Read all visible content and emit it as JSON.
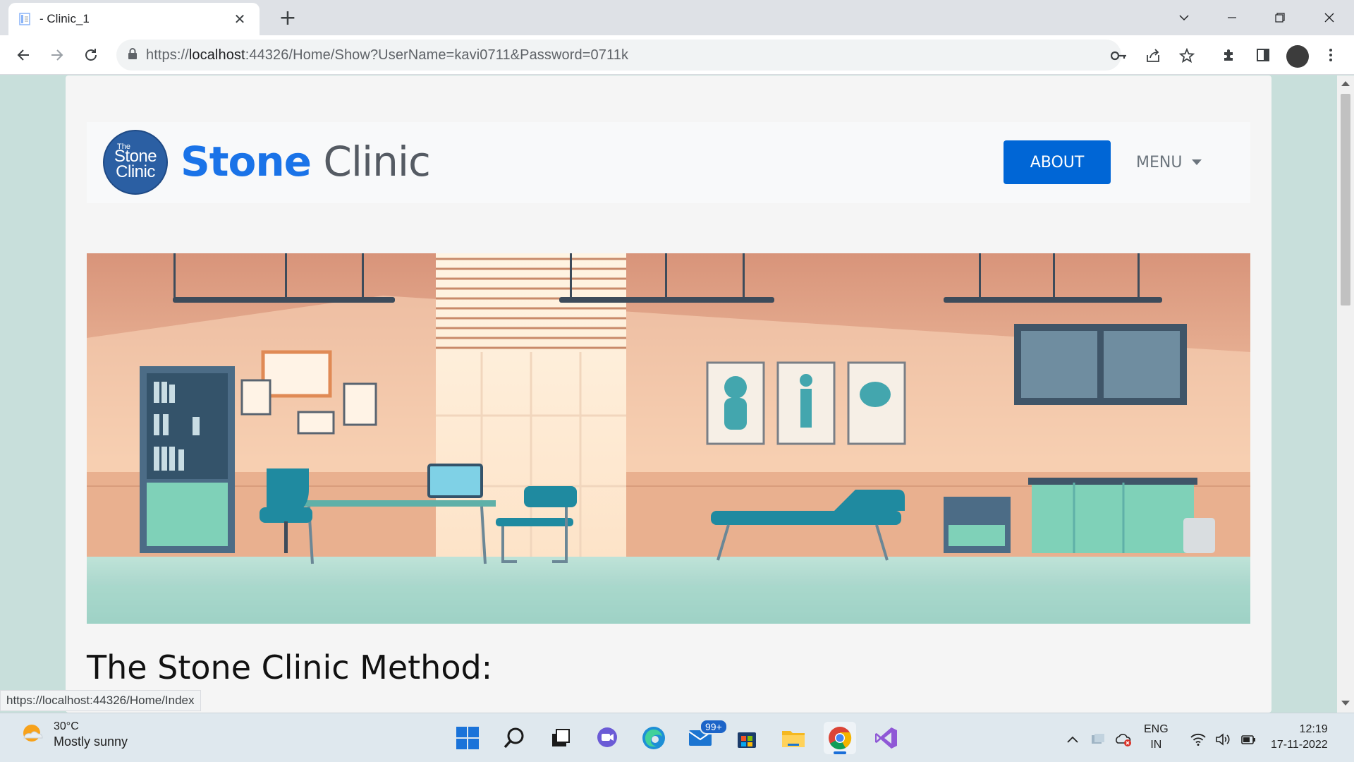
{
  "browser": {
    "tab_title": "- Clinic_1",
    "tab_close": "✕",
    "new_tab": "+",
    "url_prefix": "https://",
    "url_host": "localhost",
    "url_rest": ":44326/Home/Show?UserName=kavi0711&Password=0711k",
    "status_url": "https://localhost:44326/Home/Index"
  },
  "site": {
    "logo": {
      "line_the": "The",
      "line1": "Stone",
      "line2": "Clinic"
    },
    "brand_word1": "Stone",
    "brand_word2": "Clinic",
    "nav": {
      "about_label": "ABOUT",
      "menu_label": "MENU"
    },
    "section_title": "The Stone Clinic Method:",
    "colors": {
      "brand_blue": "#1a73e8",
      "button_blue": "#0066d6",
      "page_bg": "#c8dfdb"
    }
  },
  "taskbar": {
    "weather_temp": "30°C",
    "weather_desc": "Mostly sunny",
    "mail_badge": "99+",
    "lang_line1": "ENG",
    "lang_line2": "IN",
    "time": "12:19",
    "date": "17-11-2022",
    "apps": [
      "start-icon",
      "search-icon",
      "task-view-icon",
      "teams-chat-icon",
      "edge-icon",
      "mail-icon",
      "store-icon",
      "file-explorer-icon",
      "chrome-icon",
      "visual-studio-icon"
    ]
  }
}
